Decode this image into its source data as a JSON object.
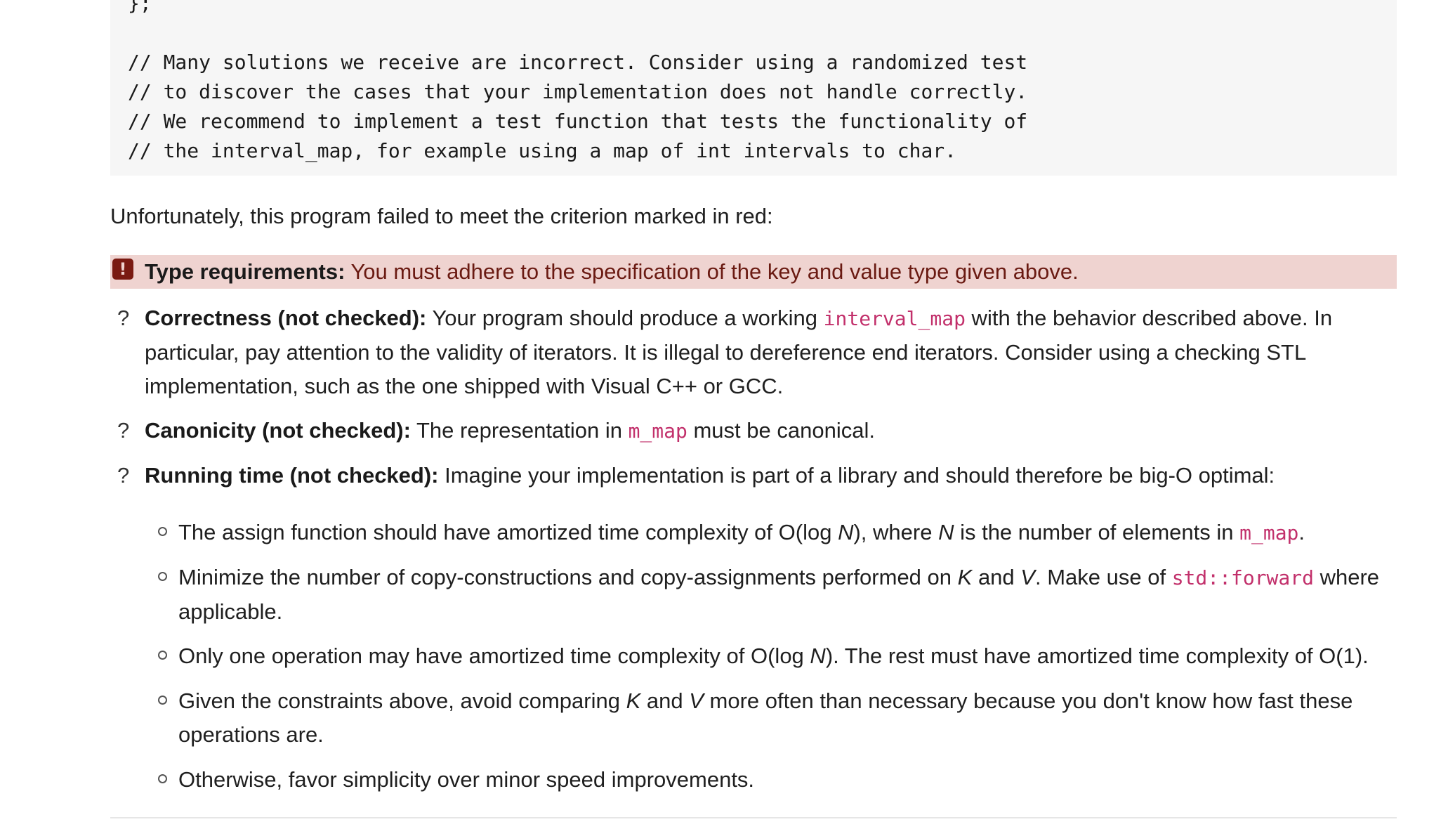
{
  "code": {
    "lines": [
      "};",
      "",
      "// Many solutions we receive are incorrect. Consider using a randomized test",
      "// to discover the cases that your implementation does not handle correctly.",
      "// We recommend to implement a test function that tests the functionality of",
      "// the interval_map, for example using a map of int intervals to char."
    ]
  },
  "intro": "Unfortunately, this program failed to meet the criterion marked in red:",
  "failed": {
    "icon": "exclamation-icon",
    "title": "Type requirements:",
    "text": " You must adhere to the specification of the key and value type given above."
  },
  "criteria": [
    {
      "mark": "?",
      "title": "Correctness (not checked):",
      "text_before": " Your program should produce a working ",
      "code": "interval_map",
      "text_after": " with the behavior described above. In particular, pay attention to the validity of iterators. It is illegal to dereference end iterators. Consider using a checking STL implementation, such as the one shipped with Visual C++ or GCC."
    },
    {
      "mark": "?",
      "title": "Canonicity (not checked):",
      "text_before": " The representation in ",
      "code": "m_map",
      "text_after": " must be canonical."
    },
    {
      "mark": "?",
      "title": "Running time (not checked):",
      "text": " Imagine your implementation is part of a library and should therefore be big-O optimal:"
    }
  ],
  "requirements": {
    "r1": {
      "a": "The assign function should have amortized time complexity of O(log ",
      "N1": "N",
      "b": "), where ",
      "N2": "N",
      "c": " is the number of elements in ",
      "code": "m_map",
      "d": "."
    },
    "r2": {
      "a": "Minimize the number of copy-constructions and copy-assignments performed on ",
      "K": "K",
      "b": " and ",
      "V": "V",
      "c": ". Make use of ",
      "code": "std::forward",
      "d": " where applicable."
    },
    "r3": {
      "a": "Only one operation may have amortized time complexity of O(log ",
      "N": "N",
      "b": "). The rest must have amortized time complexity of O(1)."
    },
    "r4": {
      "a": "Given the constraints above, avoid comparing ",
      "K": "K",
      "b": " and ",
      "V": "V",
      "c": " more often than necessary because you don't know how fast these operations are."
    },
    "r5": {
      "a": "Otherwise, favor simplicity over minor speed improvements."
    }
  }
}
